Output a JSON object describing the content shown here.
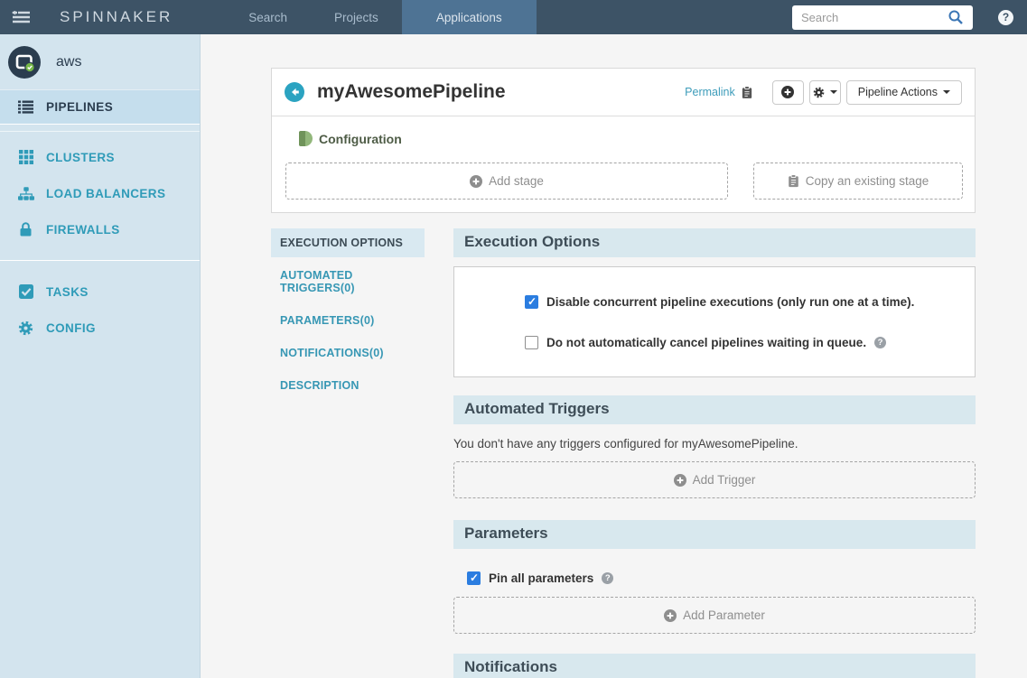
{
  "navbar": {
    "logo": "SPINNAKER",
    "tabs": [
      {
        "label": "Search",
        "active": false
      },
      {
        "label": "Projects",
        "active": false
      },
      {
        "label": "Applications",
        "active": true
      }
    ],
    "search_placeholder": "Search"
  },
  "sidebar": {
    "app_name": "aws",
    "items": [
      {
        "label": "PIPELINES",
        "icon": "list-icon",
        "active": true
      },
      {
        "label": "CLUSTERS",
        "icon": "grid-icon",
        "active": false
      },
      {
        "label": "LOAD BALANCERS",
        "icon": "sitemap-icon",
        "active": false
      },
      {
        "label": "FIREWALLS",
        "icon": "lock-icon",
        "active": false
      },
      {
        "label": "TASKS",
        "icon": "check-square-icon",
        "active": false
      },
      {
        "label": "CONFIG",
        "icon": "gear-icon",
        "active": false
      }
    ]
  },
  "pipeline": {
    "title": "myAwesomePipeline",
    "permalink_label": "Permalink",
    "actions_label": "Pipeline Actions",
    "config_tab_label": "Configuration",
    "add_stage_label": "Add stage",
    "copy_stage_label": "Copy an existing stage"
  },
  "config_nav": {
    "items": [
      {
        "label": "EXECUTION OPTIONS",
        "active": true
      },
      {
        "label": "AUTOMATED TRIGGERS(0)",
        "active": false
      },
      {
        "label": "PARAMETERS(0)",
        "active": false
      },
      {
        "label": "NOTIFICATIONS(0)",
        "active": false
      },
      {
        "label": "DESCRIPTION",
        "active": false
      }
    ]
  },
  "sections": {
    "execution_options": {
      "title": "Execution Options",
      "checkboxes": [
        {
          "label": "Disable concurrent pipeline executions (only run one at a time).",
          "checked": true,
          "help": false
        },
        {
          "label": "Do not automatically cancel pipelines waiting in queue.",
          "checked": false,
          "help": true
        }
      ]
    },
    "automated_triggers": {
      "title": "Automated Triggers",
      "empty_text": "You don't have any triggers configured for myAwesomePipeline.",
      "add_label": "Add Trigger"
    },
    "parameters": {
      "title": "Parameters",
      "pin_label": "Pin all parameters",
      "pin_checked": true,
      "add_label": "Add Parameter"
    },
    "notifications": {
      "title": "Notifications"
    }
  },
  "colors": {
    "navbar_bg": "#3d5366",
    "active_tab_bg": "#4e7394",
    "sidebar_bg": "#d3e4ee",
    "sidebar_active_bg": "#c5deed",
    "accent_teal": "#2f9bb8",
    "link_teal": "#3d9cba",
    "section_header_bg": "#d8e8ee",
    "checkbox_blue": "#2b7de0",
    "config_green_dark": "#6f935a",
    "config_green_light": "#92b77b",
    "app_icon_check_green": "#76b747"
  }
}
